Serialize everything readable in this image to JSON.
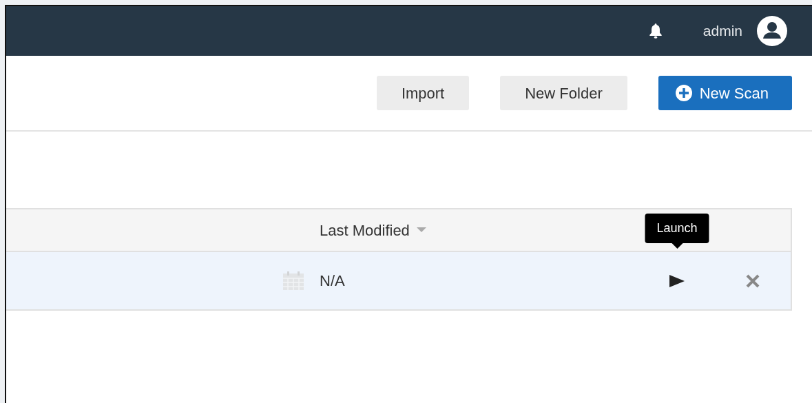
{
  "navbar": {
    "user": "admin"
  },
  "toolbar": {
    "buttons": [
      {
        "label": "Import",
        "kind": "plain"
      },
      {
        "label": "New Folder",
        "kind": "plain"
      },
      {
        "label": "New Scan",
        "kind": "primary"
      }
    ]
  },
  "table": {
    "columns": [
      {
        "label": "Last Modified",
        "sorted": true
      }
    ],
    "rows": [
      {
        "last_modified": "N/A",
        "selected": true
      }
    ],
    "tooltip": "Launch"
  }
}
